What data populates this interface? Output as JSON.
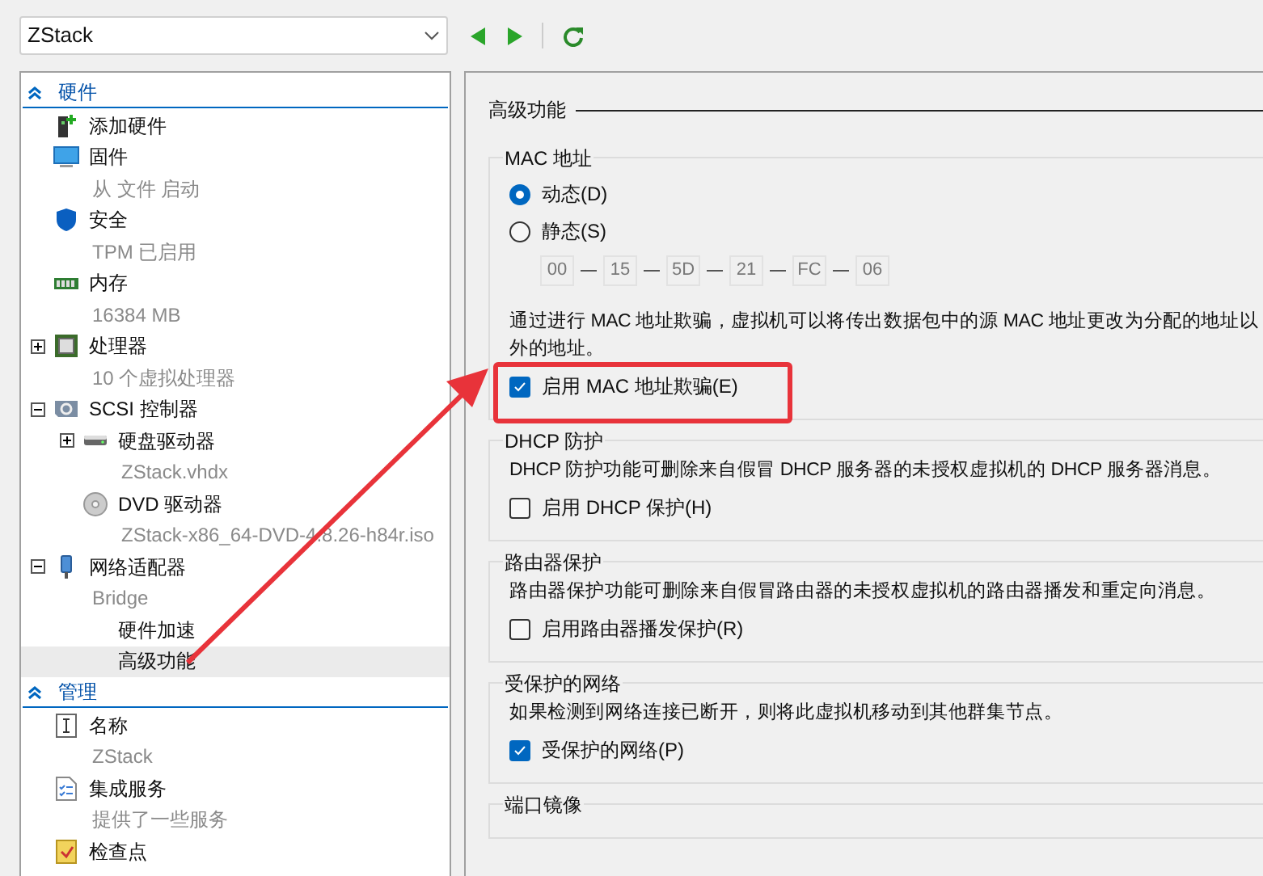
{
  "vm_selector": {
    "value": "ZStack"
  },
  "sidebar": {
    "sections": [
      {
        "title": "硬件",
        "expanded": true,
        "items": [
          {
            "kind": "add-hardware",
            "label": "添加硬件",
            "selected": false
          },
          {
            "kind": "firmware",
            "label": "固件",
            "detail": "从 文件 启动",
            "selected": false
          },
          {
            "kind": "security",
            "label": "安全",
            "detail": "TPM 已启用",
            "selected": false
          },
          {
            "kind": "memory",
            "label": "内存",
            "detail": "16384 MB",
            "selected": false
          },
          {
            "kind": "processor",
            "label": "处理器",
            "detail": "10 个虚拟处理器",
            "expanded": false,
            "selected": false
          },
          {
            "kind": "scsi",
            "label": "SCSI 控制器",
            "expanded": true,
            "selected": false,
            "children": [
              {
                "kind": "disk",
                "label": "硬盘驱动器",
                "detail": "ZStack.vhdx",
                "expanded": false,
                "selected": false
              },
              {
                "kind": "dvd",
                "label": "DVD 驱动器",
                "detail": "ZStack-x86_64-DVD-4.8.26-h84r.iso",
                "selected": false
              }
            ]
          },
          {
            "kind": "network",
            "label": "网络适配器",
            "detail": "Bridge",
            "expanded": true,
            "selected": false,
            "children": [
              {
                "kind": "plain",
                "label": "硬件加速",
                "selected": false
              },
              {
                "kind": "plain",
                "label": "高级功能",
                "selected": true
              }
            ]
          }
        ]
      },
      {
        "title": "管理",
        "expanded": true,
        "items": [
          {
            "kind": "name",
            "label": "名称",
            "detail": "ZStack",
            "selected": false
          },
          {
            "kind": "services",
            "label": "集成服务",
            "detail": "提供了一些服务",
            "selected": false
          },
          {
            "kind": "checkpoint",
            "label": "检查点",
            "selected": false
          }
        ]
      }
    ]
  },
  "panel": {
    "title": "高级功能",
    "groups": [
      {
        "title": "MAC 地址",
        "radios": [
          {
            "label": "动态(D)",
            "selected": true
          },
          {
            "label": "静态(S)",
            "selected": false
          }
        ],
        "mac_fields": [
          "00",
          "15",
          "5D",
          "21",
          "FC",
          "06"
        ],
        "description": "通过进行 MAC 地址欺骗，虚拟机可以将传出数据包中的源 MAC 地址更改为分配的地址以外的地址。",
        "checkbox": {
          "label": "启用 MAC 地址欺骗(E)",
          "checked": true
        }
      },
      {
        "title": "DHCP 防护",
        "description": "DHCP 防护功能可删除来自假冒 DHCP 服务器的未授权虚拟机的 DHCP 服务器消息。",
        "checkbox": {
          "label": "启用 DHCP 保护(H)",
          "checked": false
        }
      },
      {
        "title": "路由器保护",
        "description": "路由器保护功能可删除来自假冒路由器的未授权虚拟机的路由器播发和重定向消息。",
        "checkbox": {
          "label": "启用路由器播发保护(R)",
          "checked": false
        }
      },
      {
        "title": "受保护的网络",
        "description": "如果检测到网络连接已断开，则将此虚拟机移动到其他群集节点。",
        "checkbox": {
          "label": "受保护的网络(P)",
          "checked": true
        }
      },
      {
        "title": "端口镜像"
      }
    ]
  }
}
